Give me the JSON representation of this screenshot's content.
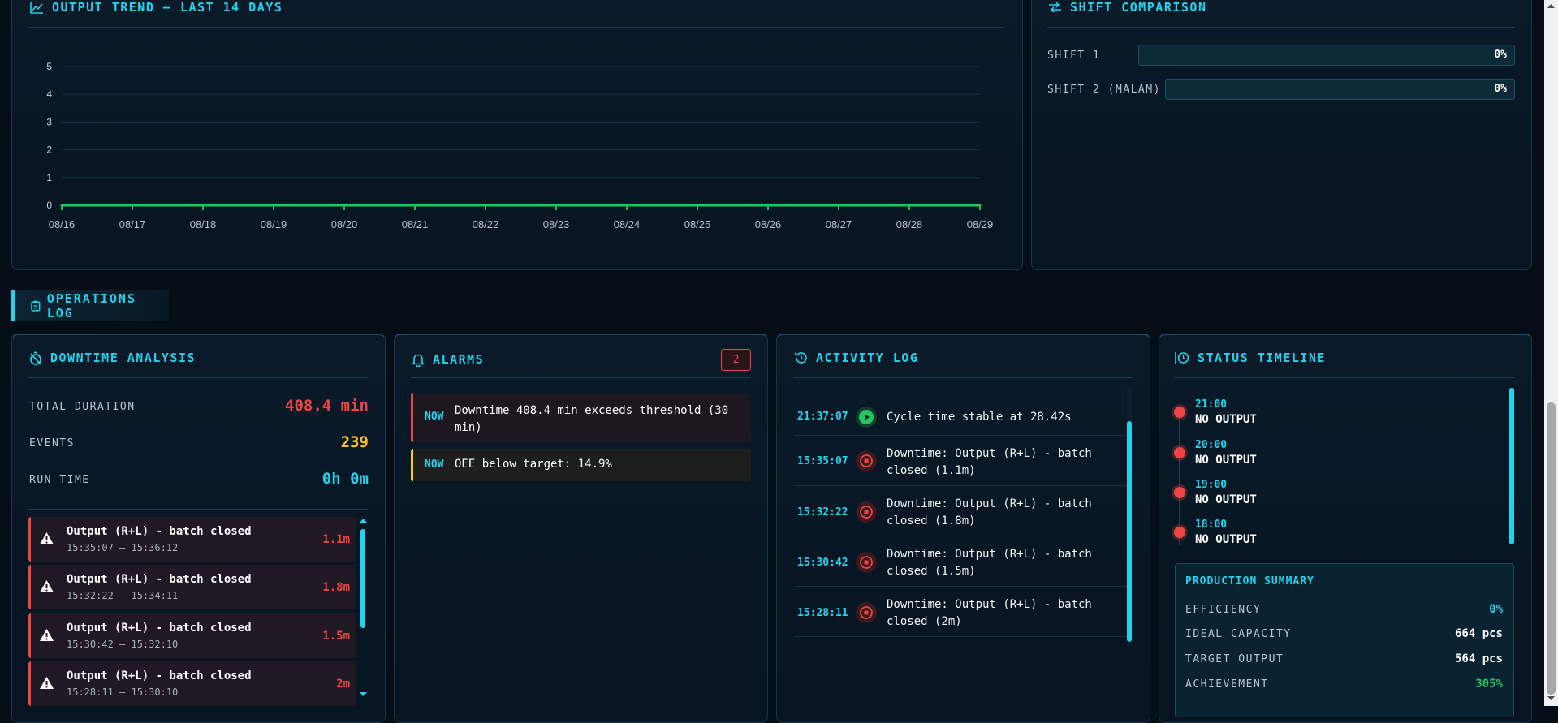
{
  "trend": {
    "title": "OUTPUT TREND — LAST 14 DAYS",
    "chart_data": {
      "type": "line",
      "categories": [
        "08/16",
        "08/17",
        "08/18",
        "08/19",
        "08/20",
        "08/21",
        "08/22",
        "08/23",
        "08/24",
        "08/25",
        "08/26",
        "08/27",
        "08/28",
        "08/29"
      ],
      "series": [
        {
          "values": [
            0,
            0,
            0,
            0,
            0,
            0,
            0,
            0,
            0,
            0,
            0,
            0,
            0,
            0
          ],
          "color": "#22c55e"
        }
      ],
      "ylim": [
        0,
        5
      ],
      "yticks": [
        0,
        1,
        2,
        3,
        4,
        5
      ],
      "grid": true
    }
  },
  "shift": {
    "title": "SHIFT COMPARISON",
    "rows": [
      {
        "label": "SHIFT 1",
        "value": "0%",
        "fraction": 0
      },
      {
        "label": "SHIFT 2 (MALAM)",
        "value": "0%",
        "fraction": 0
      }
    ]
  },
  "ops": {
    "title": "OPERATIONS LOG"
  },
  "downtime": {
    "title": "DOWNTIME ANALYSIS",
    "stats": [
      {
        "label": "TOTAL DURATION",
        "value": "408.4 min",
        "color": "#ef4444"
      },
      {
        "label": "EVENTS",
        "value": "239",
        "color": "#fbbf24"
      },
      {
        "label": "RUN TIME",
        "value": "0h 0m",
        "color": "#22d3ee"
      }
    ],
    "items": [
      {
        "title": "Output (R+L) - batch closed",
        "range": "15:35:07 – 15:36:12",
        "duration": "1.1m"
      },
      {
        "title": "Output (R+L) - batch closed",
        "range": "15:32:22 – 15:34:11",
        "duration": "1.8m"
      },
      {
        "title": "Output (R+L) - batch closed",
        "range": "15:30:42 – 15:32:10",
        "duration": "1.5m"
      },
      {
        "title": "Output (R+L) - batch closed",
        "range": "15:28:11 – 15:30:10",
        "duration": "2m"
      }
    ]
  },
  "alarms": {
    "title": "ALARMS",
    "count": "2",
    "items": [
      {
        "tag": "NOW",
        "message": "Downtime 408.4 min exceeds threshold (30 min)",
        "level": "critical"
      },
      {
        "tag": "NOW",
        "message": "OEE below target: 14.9%",
        "level": "warning"
      }
    ]
  },
  "activity": {
    "title": "ACTIVITY LOG",
    "items": [
      {
        "time": "21:37:07",
        "text": "Cycle time stable at 28.42s",
        "kind": "run"
      },
      {
        "time": "15:35:07",
        "text": "Downtime: Output (R+L) - batch closed (1.1m)",
        "kind": "stop"
      },
      {
        "time": "15:32:22",
        "text": "Downtime: Output (R+L) - batch closed (1.8m)",
        "kind": "stop"
      },
      {
        "time": "15:30:42",
        "text": "Downtime: Output (R+L) - batch closed (1.5m)",
        "kind": "stop"
      },
      {
        "time": "15:28:11",
        "text": "Downtime: Output (R+L) - batch closed (2m)",
        "kind": "stop"
      }
    ]
  },
  "timeline": {
    "title": "STATUS TIMELINE",
    "items": [
      {
        "time": "21:00",
        "status": "NO OUTPUT"
      },
      {
        "time": "20:00",
        "status": "NO OUTPUT"
      },
      {
        "time": "19:00",
        "status": "NO OUTPUT"
      },
      {
        "time": "18:00",
        "status": "NO OUTPUT"
      }
    ]
  },
  "summary": {
    "title": "PRODUCTION SUMMARY",
    "rows": [
      {
        "label": "EFFICIENCY",
        "value": "0%",
        "color": "#22d3ee"
      },
      {
        "label": "IDEAL CAPACITY",
        "value": "664 pcs",
        "color": "#ffffff"
      },
      {
        "label": "TARGET OUTPUT",
        "value": "564 pcs",
        "color": "#ffffff"
      },
      {
        "label": "ACHIEVEMENT",
        "value": "305%",
        "color": "#22c55e"
      }
    ]
  }
}
